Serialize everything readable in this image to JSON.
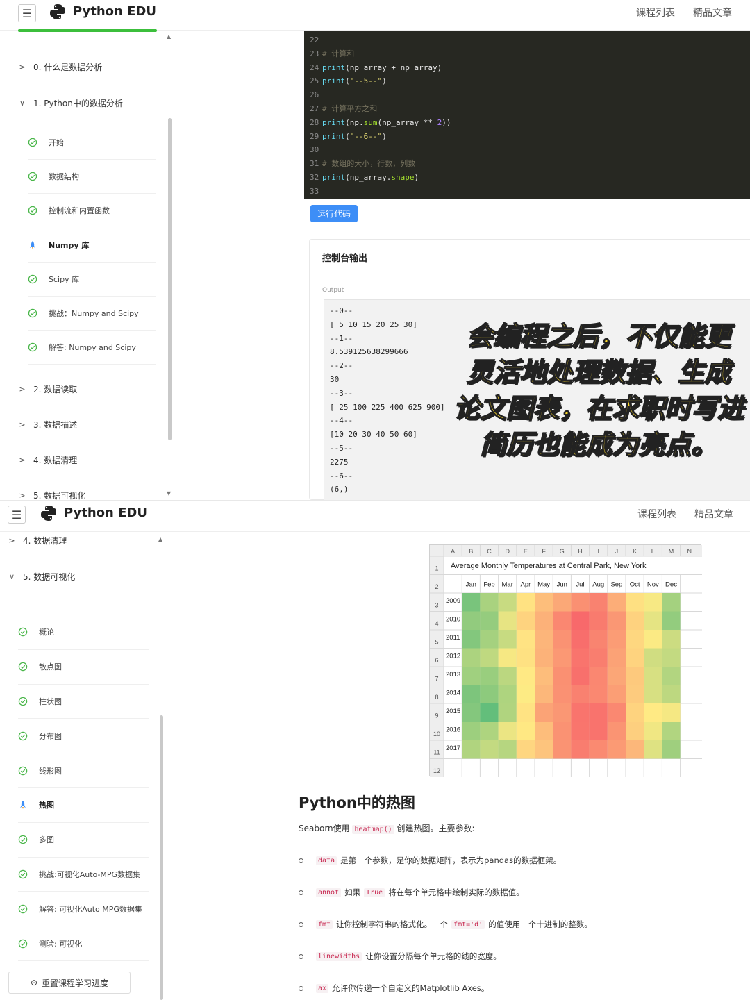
{
  "app": {
    "brand": "Python EDU",
    "nav": [
      "课程列表",
      "精品文章"
    ]
  },
  "panel1": {
    "sidebar": {
      "sections": [
        {
          "label": "0. 什么是数据分析",
          "expanded": false
        },
        {
          "label": "1. Python中的数据分析",
          "expanded": true
        },
        {
          "label": "2. 数据读取",
          "expanded": false
        },
        {
          "label": "3. 数据描述",
          "expanded": false
        },
        {
          "label": "4. 数据清理",
          "expanded": false
        },
        {
          "label": "5. 数据可视化",
          "expanded": false
        }
      ],
      "lessons": [
        {
          "label": "开始",
          "state": "done"
        },
        {
          "label": "数据结构",
          "state": "done"
        },
        {
          "label": "控制流和内置函数",
          "state": "done"
        },
        {
          "label": "Numpy 库",
          "state": "current"
        },
        {
          "label": "Scipy 库",
          "state": "done"
        },
        {
          "label": "挑战：Numpy and Scipy",
          "state": "done"
        },
        {
          "label": "解答: Numpy and Scipy",
          "state": "done"
        }
      ]
    },
    "code_lines": [
      {
        "n": "22",
        "text": ""
      },
      {
        "n": "23",
        "text": "# 计算和"
      },
      {
        "n": "24",
        "text": "print(np_array + np_array)"
      },
      {
        "n": "25",
        "text": "print(\"--5--\")"
      },
      {
        "n": "26",
        "text": ""
      },
      {
        "n": "27",
        "text": "# 计算平方之和"
      },
      {
        "n": "28",
        "text": "print(np.sum(np_array ** 2))"
      },
      {
        "n": "29",
        "text": "print(\"--6--\")"
      },
      {
        "n": "30",
        "text": ""
      },
      {
        "n": "31",
        "text": "# 数组的大小，行数，列数"
      },
      {
        "n": "32",
        "text": "print(np_array.shape)"
      },
      {
        "n": "33",
        "text": ""
      }
    ],
    "run_button": "运行代码",
    "console": {
      "title": "控制台输出",
      "output_label": "Output",
      "lines": [
        "--0--",
        "[ 5 10 15 20 25 30]",
        "--1--",
        "8.539125638299666",
        "--2--",
        "30",
        "--3--",
        "[ 25 100 225 400 625 900]",
        "--4--",
        "[10 20 30 40 50 60]",
        "--5--",
        "2275",
        "--6--",
        "(6,)"
      ]
    },
    "overlay_lines": [
      "会编程之后，不仅能更",
      "灵活地处理数据、生成",
      "论文图表，在求职时写进",
      "简历也能成为亮点。"
    ]
  },
  "panel2": {
    "sidebar": {
      "sections": [
        {
          "label": "4. 数据清理",
          "expanded": false
        },
        {
          "label": "5. 数据可视化",
          "expanded": true
        }
      ],
      "lessons": [
        {
          "label": "概论",
          "state": "done"
        },
        {
          "label": "散点图",
          "state": "done"
        },
        {
          "label": "柱状图",
          "state": "done"
        },
        {
          "label": "分布图",
          "state": "done"
        },
        {
          "label": "线形图",
          "state": "done"
        },
        {
          "label": "热图",
          "state": "current"
        },
        {
          "label": "多图",
          "state": "done"
        },
        {
          "label": "挑战:可视化Auto-MPG数据集",
          "state": "done"
        },
        {
          "label": "解答: 可视化Auto MPG数据集",
          "state": "done"
        },
        {
          "label": "测验: 可视化",
          "state": "done"
        }
      ],
      "reset_button": "重置课程学习进度"
    },
    "sheet": {
      "col_letters": [
        "A",
        "B",
        "C",
        "D",
        "E",
        "F",
        "G",
        "H",
        "I",
        "J",
        "K",
        "L",
        "M",
        "N"
      ],
      "row_numbers": [
        "1",
        "2",
        "3",
        "4",
        "5",
        "6",
        "7",
        "8",
        "9",
        "10",
        "11",
        "12"
      ],
      "title": "Average Monthly Temperatures at Central Park, New York",
      "months": [
        "Jan",
        "Feb",
        "Mar",
        "Apr",
        "May",
        "Jun",
        "Jul",
        "Aug",
        "Sep",
        "Oct",
        "Nov",
        "Dec"
      ],
      "years": [
        "2009",
        "2010",
        "2011",
        "2012",
        "2013",
        "2014",
        "2015",
        "2016",
        "2017"
      ],
      "colors": {
        "cold": "#63be7b",
        "mid": "#ffeb84",
        "hot": "#f8696b"
      }
    },
    "article": {
      "title": "Python中的热图",
      "intro_before": "Seaborn使用",
      "intro_code": "heatmap()",
      "intro_after": "创建热图。主要参数:",
      "bullets": [
        {
          "code": "data",
          "text": "是第一个参数，是你的数据矩阵，表示为pandas的数据框架。"
        },
        {
          "code": "annot",
          "text": "如果",
          "code2": "True",
          "text2": "将在每个单元格中绘制实际的数据值。"
        },
        {
          "code": "fmt",
          "text": "让你控制字符串的格式化。一个",
          "code2": "fmt='d'",
          "text2": "的值使用一个十进制的整数。"
        },
        {
          "code": "linewidths",
          "text": "让你设置分隔每个单元格的线的宽度。"
        },
        {
          "code": "ax",
          "text": "允许你传递一个自定义的Matplotlib Axes。"
        }
      ]
    }
  },
  "chart_data": {
    "type": "heatmap",
    "title": "Average Monthly Temperatures at Central Park, New York",
    "x": [
      "Jan",
      "Feb",
      "Mar",
      "Apr",
      "May",
      "Jun",
      "Jul",
      "Aug",
      "Sep",
      "Oct",
      "Nov",
      "Dec"
    ],
    "y": [
      "2009",
      "2010",
      "2011",
      "2012",
      "2013",
      "2014",
      "2015",
      "2016",
      "2017"
    ],
    "values": [
      [
        27.9,
        36.7,
        42.4,
        54.5,
        62.5,
        67.5,
        72.7,
        75.7,
        66.3,
        55.0,
        51.1,
        35.9
      ],
      [
        32.5,
        33.1,
        48.2,
        57.9,
        65.3,
        74.7,
        81.3,
        77.4,
        71.1,
        58.1,
        47.9,
        32.8
      ],
      [
        29.7,
        36.0,
        42.3,
        54.3,
        64.5,
        72.3,
        80.2,
        75.3,
        70.0,
        57.1,
        51.9,
        43.3
      ],
      [
        37.3,
        40.9,
        50.9,
        54.8,
        65.1,
        71.0,
        78.8,
        76.7,
        68.8,
        58.0,
        43.9,
        41.5
      ],
      [
        35.1,
        33.9,
        40.1,
        53.0,
        62.8,
        72.7,
        79.8,
        74.6,
        67.9,
        60.2,
        45.3,
        38.5
      ],
      [
        28.6,
        31.6,
        37.7,
        52.3,
        64.0,
        72.5,
        76.1,
        74.5,
        69.7,
        59.6,
        45.3,
        40.5
      ],
      [
        29.9,
        23.9,
        38.1,
        54.3,
        68.5,
        71.2,
        78.8,
        79.0,
        74.5,
        58.0,
        52.8,
        50.8
      ],
      [
        34.5,
        37.7,
        48.9,
        53.3,
        62.8,
        72.3,
        78.7,
        79.2,
        71.8,
        58.8,
        49.8,
        38.3
      ],
      [
        38.0,
        41.6,
        39.2,
        57.2,
        61.1,
        72.0,
        76.8,
        74.0,
        70.5,
        64.1,
        46.6,
        35.0
      ]
    ]
  }
}
